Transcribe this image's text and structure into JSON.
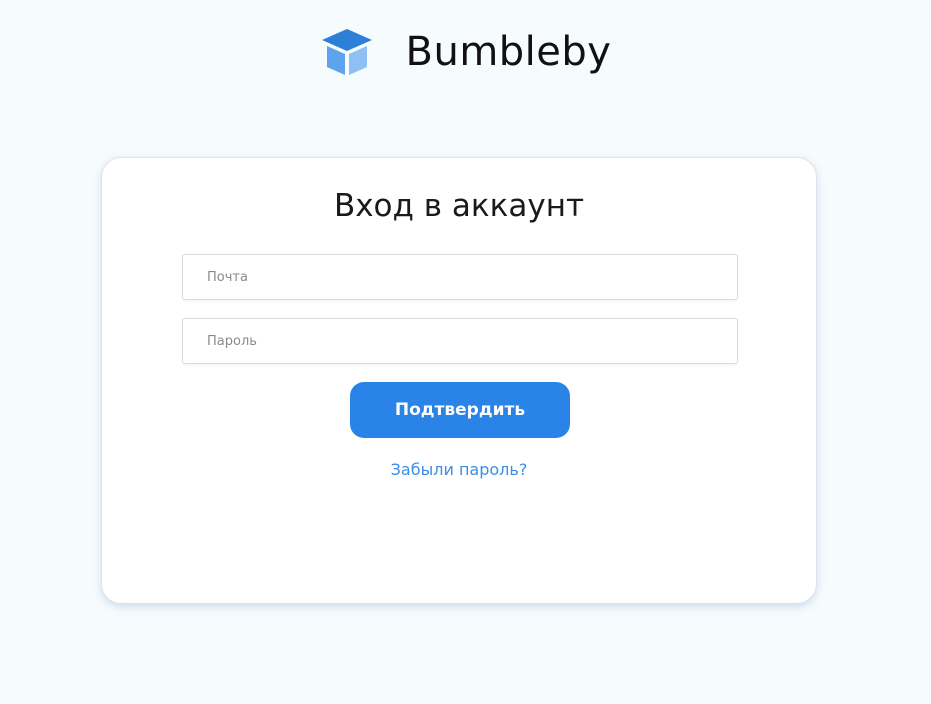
{
  "header": {
    "logo_icon": "graduation-cap-cube-icon",
    "brand_name": "Bumbleby"
  },
  "login": {
    "title": "Вход в аккаунт",
    "email_placeholder": "Почта",
    "email_value": "",
    "password_placeholder": "Пароль",
    "password_value": "",
    "submit_label": "Подтвердить",
    "forgot_password_label": "Забыли пароль?"
  },
  "colors": {
    "background": "#f6fbfd",
    "accent": "#2a84e8",
    "link": "#3a8ee6",
    "logo_dark": "#2e7fd8",
    "logo_light": "#8ec0f4"
  }
}
